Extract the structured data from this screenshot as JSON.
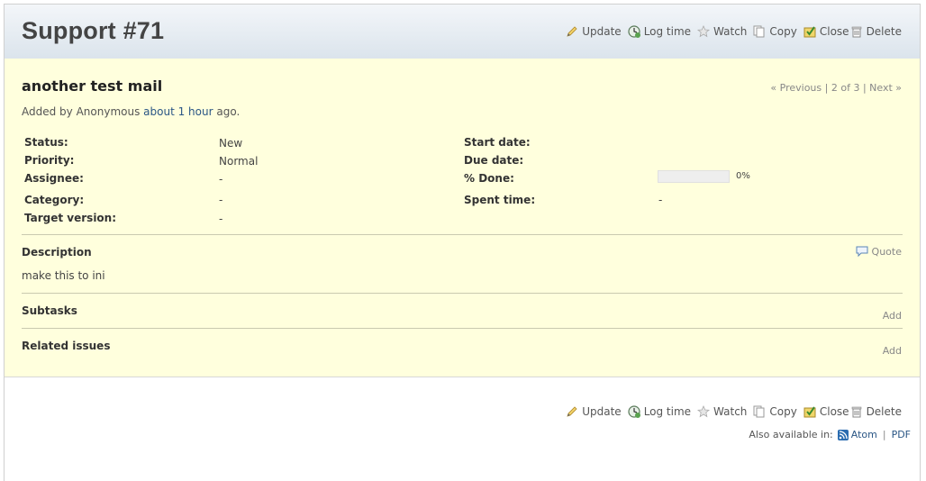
{
  "header": {
    "title": "Support #71",
    "actions": [
      {
        "label": "Update",
        "icon": "edit-icon"
      },
      {
        "label": "Log time",
        "icon": "clock-icon"
      },
      {
        "label": "Watch",
        "icon": "star-icon"
      },
      {
        "label": "Copy",
        "icon": "copy-icon"
      },
      {
        "label": "Close",
        "icon": "close-issue-icon"
      },
      {
        "label": "Delete",
        "icon": "trash-icon"
      }
    ]
  },
  "issue": {
    "subject": "another test mail",
    "nav": {
      "previous": "« Previous",
      "position": "2 of 3",
      "next": "Next »"
    },
    "author": {
      "prefix": "Added by Anonymous",
      "time": "about 1 hour",
      "suffix": "ago."
    },
    "attributes_left": [
      {
        "label": "Status:",
        "value": "New"
      },
      {
        "label": "Priority:",
        "value": "Normal"
      },
      {
        "label": "Assignee:",
        "value": "-"
      },
      {
        "label": "Category:",
        "value": "-"
      },
      {
        "label": "Target version:",
        "value": "-"
      }
    ],
    "attributes_right": [
      {
        "label": "Start date:",
        "value": ""
      },
      {
        "label": "Due date:",
        "value": ""
      },
      {
        "label": "% Done:",
        "value": "0%"
      },
      {
        "label": "Spent time:",
        "value": "-"
      }
    ],
    "done_ratio": 0,
    "description": {
      "title": "Description",
      "quote": "Quote",
      "text": "make this to ini"
    },
    "subtasks": {
      "title": "Subtasks",
      "add": "Add"
    },
    "related": {
      "title": "Related issues",
      "add": "Add"
    }
  },
  "footer": {
    "also_available": "Also available in:",
    "formats": [
      "Atom",
      "PDF"
    ],
    "separator": "|"
  },
  "colors": {
    "issue_bg": "#ffffdd",
    "link": "#2a5685",
    "progress_empty": "#eeeeee"
  }
}
